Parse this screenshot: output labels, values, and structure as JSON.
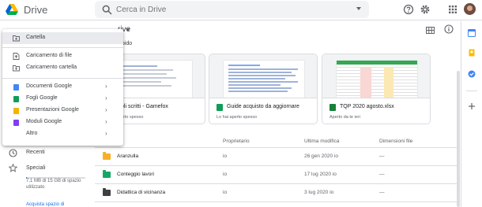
{
  "header": {
    "app_title": "Drive",
    "search_placeholder": "Cerca in Drive",
    "icons": [
      "google-drive-logo",
      "search-icon",
      "support-icon",
      "settings-icon",
      "apps-icon",
      "avatar"
    ]
  },
  "toolbar": {
    "location": "rive",
    "view_icons": [
      "grid-view-icon",
      "info-icon"
    ]
  },
  "quick_access": {
    "label": "epido",
    "cards": [
      {
        "title": "oli scritti - Gamefox",
        "subtitle": "erto spesso",
        "file_type": "doc"
      },
      {
        "title": "Guide acquisto da aggiornare",
        "subtitle": "Lo hai aperto spesso",
        "file_type": "sheet"
      },
      {
        "title": "TQP 2020 agosto.xlsx",
        "subtitle": "Aperto da te ieri",
        "file_type": "excel"
      }
    ]
  },
  "file_list": {
    "columns": [
      "Proprietario",
      "Ultima modifica",
      "Dimensioni file"
    ],
    "rows": [
      {
        "name": "Aranzulla",
        "owner": "io",
        "modified": "26 gen 2020",
        "modified_by": "io",
        "size": "—",
        "icon_color": "#f6b026"
      },
      {
        "name": "Conteggio lavori",
        "owner": "io",
        "modified": "17 lug 2020",
        "modified_by": "io",
        "size": "—",
        "icon_color": "#16a765"
      },
      {
        "name": "Didattica di vicinanza",
        "owner": "io",
        "modified": "3 lug 2020",
        "modified_by": "io",
        "size": "—",
        "icon_color": "#3c4043"
      }
    ]
  },
  "sidebar": {
    "recent": "Recenti",
    "starred": "Speciali",
    "storage_text": "7,1 MB di 15 GB di spazio utilizzato",
    "storage_fraction": 0.0005,
    "buy_storage": "Acquista spazio di"
  },
  "new_menu": {
    "items": [
      {
        "label": "Cartella",
        "icon": "folder-plus-icon",
        "submenu": false
      },
      {
        "label": "Caricamento di file",
        "icon": "file-upload-icon",
        "submenu": false
      },
      {
        "label": "Caricamento cartella",
        "icon": "folder-upload-icon",
        "submenu": false
      },
      {
        "label": "Documenti Google",
        "icon": "google-docs-icon",
        "color": "#4285f4",
        "submenu": true
      },
      {
        "label": "Fogli Google",
        "icon": "google-sheets-icon",
        "color": "#0f9d58",
        "submenu": true
      },
      {
        "label": "Presentazioni Google",
        "icon": "google-slides-icon",
        "color": "#f4b400",
        "submenu": true
      },
      {
        "label": "Moduli Google",
        "icon": "google-forms-icon",
        "color": "#7e3ff2",
        "submenu": true
      },
      {
        "label": "Altro",
        "icon": "",
        "submenu": true
      }
    ],
    "submenu_arrow": "›"
  },
  "right_panel": {
    "icons": [
      "calendar-icon",
      "keep-icon",
      "tasks-icon",
      "add-addon-icon"
    ]
  }
}
